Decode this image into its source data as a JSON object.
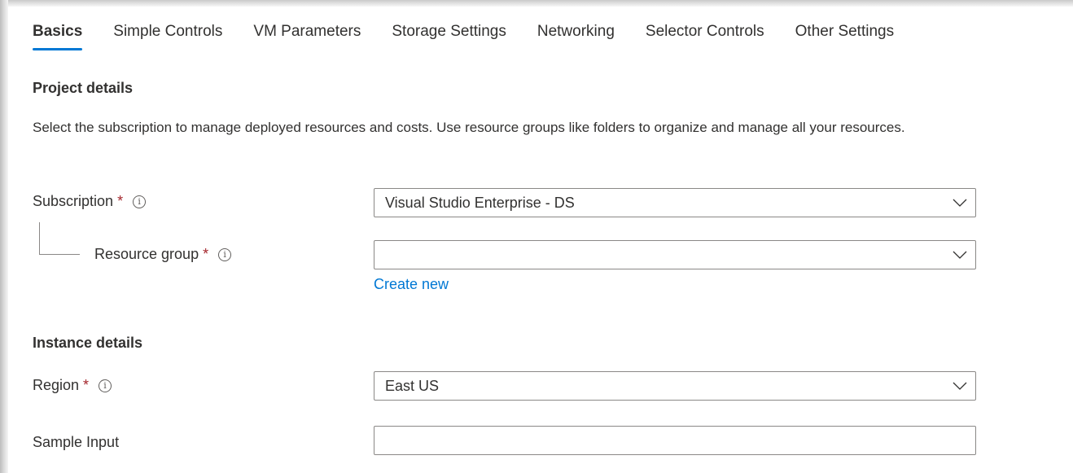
{
  "tabs": [
    {
      "label": "Basics",
      "active": true
    },
    {
      "label": "Simple Controls",
      "active": false
    },
    {
      "label": "VM Parameters",
      "active": false
    },
    {
      "label": "Storage Settings",
      "active": false
    },
    {
      "label": "Networking",
      "active": false
    },
    {
      "label": "Selector Controls",
      "active": false
    },
    {
      "label": "Other Settings",
      "active": false
    }
  ],
  "project": {
    "title": "Project details",
    "description": "Select the subscription to manage deployed resources and costs. Use resource groups like folders to organize and manage all your resources."
  },
  "subscription": {
    "label": "Subscription",
    "required_mark": "*",
    "info_icon": "info-icon",
    "value": "Visual Studio Enterprise - DS"
  },
  "resource_group": {
    "label": "Resource group",
    "required_mark": "*",
    "info_icon": "info-icon",
    "value": "",
    "create_new_link": "Create new"
  },
  "instance": {
    "title": "Instance details"
  },
  "region": {
    "label": "Region",
    "required_mark": "*",
    "info_icon": "info-icon",
    "value": "East US"
  },
  "sample_input": {
    "label": "Sample Input",
    "value": ""
  },
  "colors": {
    "accent": "#0078d4",
    "required": "#a4262c",
    "text": "#323130",
    "border": "#8a8886"
  }
}
